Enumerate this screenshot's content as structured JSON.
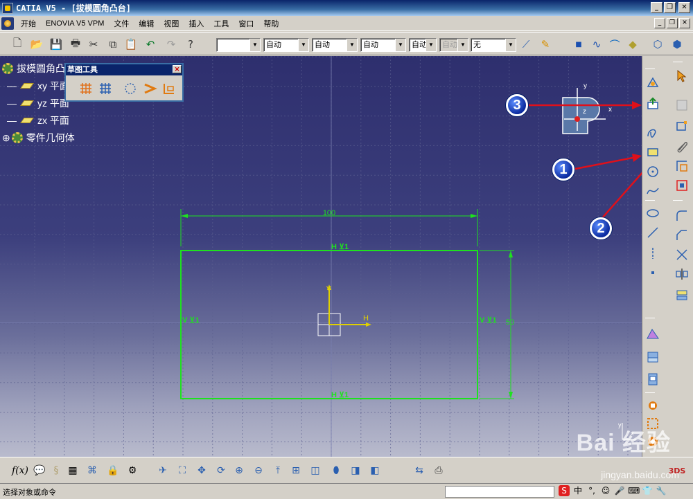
{
  "window": {
    "title": "CATIA V5 - [拔模圆角凸台]"
  },
  "menu": {
    "items": [
      "开始",
      "ENOVIA V5 VPM",
      "文件",
      "编辑",
      "视图",
      "插入",
      "工具",
      "窗口",
      "帮助"
    ]
  },
  "toolbar": {
    "combos": [
      "",
      "自动",
      "自动",
      "自动",
      "自动",
      "自动",
      "无"
    ]
  },
  "tree": {
    "root": "拔模圆角凸台",
    "items": [
      {
        "label": "xy 平面"
      },
      {
        "label": "yz 平面"
      },
      {
        "label": "zx 平面"
      },
      {
        "label": "零件几何体"
      }
    ]
  },
  "sketch_panel": {
    "title": "草图工具"
  },
  "sketch": {
    "dim_width": "100",
    "dim_height": "50",
    "axis_h": "H",
    "axis_v": "V",
    "compass_x": "x",
    "compass_y": "y",
    "compass_z": "z",
    "corner_y": "y",
    "corner_x": "x"
  },
  "callouts": [
    "1",
    "2",
    "3"
  ],
  "status": {
    "text": "选择对象或命令"
  },
  "watermark": {
    "brand": "Bai 经验",
    "url": "jingyan.baidu.com"
  },
  "colors": {
    "sketch_green": "#1ee21e",
    "arrow_red": "#e0101a",
    "callout_blue": "#0b2a9e"
  }
}
